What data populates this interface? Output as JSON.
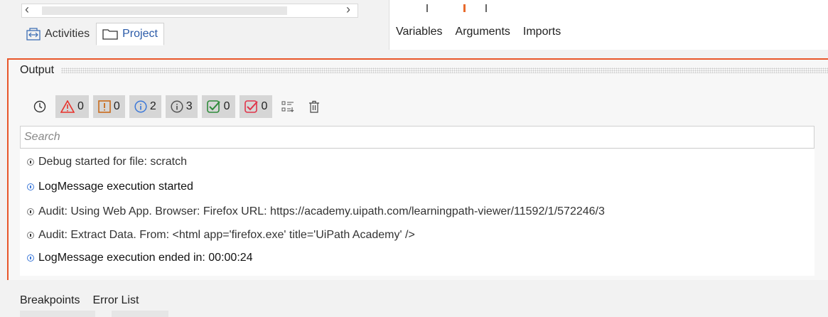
{
  "panel_tabs": [
    {
      "label": "Activities",
      "icon": "activities-icon",
      "active": false
    },
    {
      "label": "Project",
      "icon": "folder-icon",
      "active": true
    }
  ],
  "designer_tabs": [
    "Variables",
    "Arguments",
    "Imports"
  ],
  "output": {
    "title": "Output",
    "filters": [
      {
        "name": "errors",
        "count": "0",
        "icon": "error-triangle-icon",
        "color": "#e8312a"
      },
      {
        "name": "warnings",
        "count": "0",
        "icon": "warning-icon",
        "color": "#c96a1a"
      },
      {
        "name": "info",
        "count": "2",
        "icon": "info-icon",
        "color": "#3c78d8"
      },
      {
        "name": "trace",
        "count": "3",
        "icon": "trace-icon",
        "color": "#555555"
      },
      {
        "name": "success",
        "count": "0",
        "icon": "check-success-icon",
        "color": "#2e8b3a"
      },
      {
        "name": "failed",
        "count": "0",
        "icon": "check-failed-icon",
        "color": "#e0344a"
      }
    ],
    "search_placeholder": "Search",
    "logs": [
      {
        "text": "Debug started for file: scratch",
        "level": "trace"
      },
      {
        "text": "LogMessage execution started",
        "level": "info"
      },
      {
        "text": "Audit: Using Web App. Browser: Firefox URL: https://academy.uipath.com/learningpath-viewer/11592/1/572246/3",
        "level": "trace"
      },
      {
        "text": "Audit: Extract Data. From: <html app='firefox.exe' title='UiPath Academy' />",
        "level": "trace"
      },
      {
        "text": "LogMessage execution ended in: 00:00:24",
        "level": "info"
      }
    ]
  },
  "bottom_tabs": [
    "Breakpoints",
    "Error List"
  ]
}
